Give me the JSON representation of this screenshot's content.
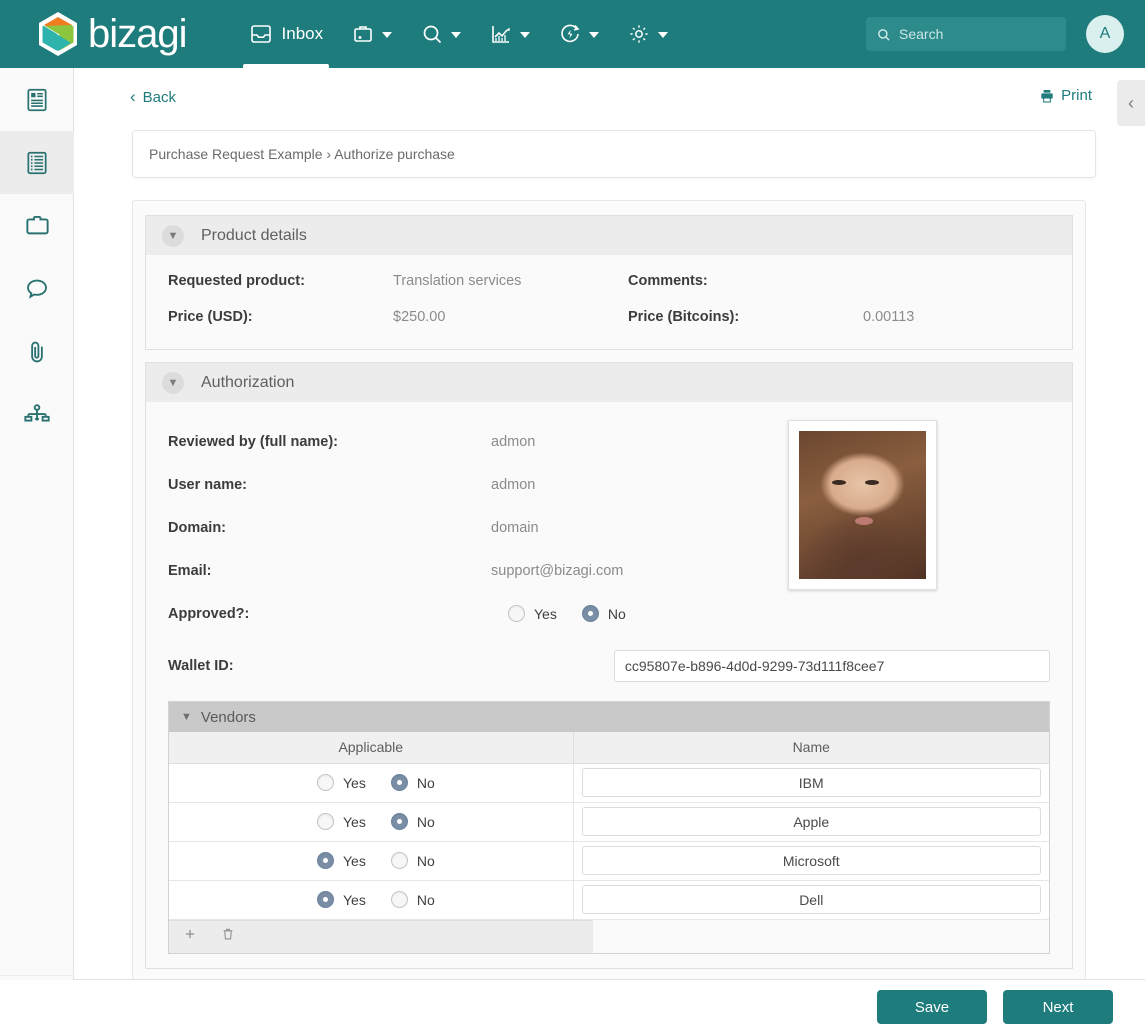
{
  "brand": {
    "name": "bizagi",
    "teal": "#1f7c7c",
    "logo_icon": "bizagi-hexagon-logo"
  },
  "topnav": {
    "items": [
      {
        "label": "Inbox",
        "icon": "inbox-icon",
        "active": true,
        "caret": false
      },
      {
        "label": "",
        "icon": "new-case-briefcase-icon",
        "active": false,
        "caret": true
      },
      {
        "label": "",
        "icon": "search-icon",
        "active": false,
        "caret": true
      },
      {
        "label": "",
        "icon": "analytics-chart-icon",
        "active": false,
        "caret": true
      },
      {
        "label": "",
        "icon": "performance-bolt-icon",
        "active": false,
        "caret": true
      },
      {
        "label": "",
        "icon": "gear-icon",
        "active": false,
        "caret": true
      }
    ],
    "search": {
      "placeholder": "Search",
      "icon": "search-icon"
    },
    "avatar": {
      "initial": "A"
    }
  },
  "rail": {
    "items": [
      {
        "icon": "summary-card-icon",
        "active": false
      },
      {
        "icon": "activity-list-icon",
        "active": true
      },
      {
        "icon": "folder-icon",
        "active": false
      },
      {
        "icon": "comment-bubble-icon",
        "active": false
      },
      {
        "icon": "paperclip-attachment-icon",
        "active": false
      },
      {
        "icon": "process-diagram-icon",
        "active": false
      }
    ],
    "expand_icon": "double-chevron-right-icon"
  },
  "actionbar": {
    "back_label": "Back",
    "back_icon": "chevron-left-icon",
    "print_label": "Print",
    "print_icon": "printer-icon",
    "collapse_icon": "chevron-left-icon"
  },
  "breadcrumb": {
    "text": "Purchase Request Example › Authorize purchase"
  },
  "sections": {
    "product_details": {
      "title": "Product details",
      "toggle_icon": "chevron-down-icon",
      "fields": {
        "requested_product_label": "Requested product:",
        "requested_product_value": "Translation services",
        "comments_label": "Comments:",
        "comments_value": "",
        "price_usd_label": "Price (USD):",
        "price_usd_value": "$250.00",
        "price_btc_label": "Price (Bitcoins):",
        "price_btc_value": "0.00113"
      }
    },
    "authorization": {
      "title": "Authorization",
      "toggle_icon": "chevron-down-icon",
      "fields": [
        {
          "label": "Reviewed by (full name):",
          "value": "admon"
        },
        {
          "label": "User name:",
          "value": "admon"
        },
        {
          "label": "Domain:",
          "value": "domain"
        },
        {
          "label": "Email:",
          "value": "support@bizagi.com"
        }
      ],
      "approved": {
        "label": "Approved?:",
        "yes_label": "Yes",
        "no_label": "No",
        "selected": "No"
      },
      "wallet": {
        "label": "Wallet ID:",
        "value": "cc95807e-b896-4d0d-9299-73d111f8cee7",
        "placeholder": ""
      },
      "photo": {
        "alt": "reviewer-photo"
      },
      "vendors": {
        "title": "Vendors",
        "toggle_icon": "chevron-down-icon",
        "columns": [
          "Applicable",
          "Name"
        ],
        "yes_label": "Yes",
        "no_label": "No",
        "rows": [
          {
            "applicable": "No",
            "name": "IBM"
          },
          {
            "applicable": "No",
            "name": "Apple"
          },
          {
            "applicable": "Yes",
            "name": "Microsoft"
          },
          {
            "applicable": "Yes",
            "name": "Dell"
          }
        ],
        "toolbar": {
          "add_icon": "plus-icon",
          "delete_icon": "trash-icon"
        }
      }
    }
  },
  "footer": {
    "save_label": "Save",
    "next_label": "Next"
  }
}
